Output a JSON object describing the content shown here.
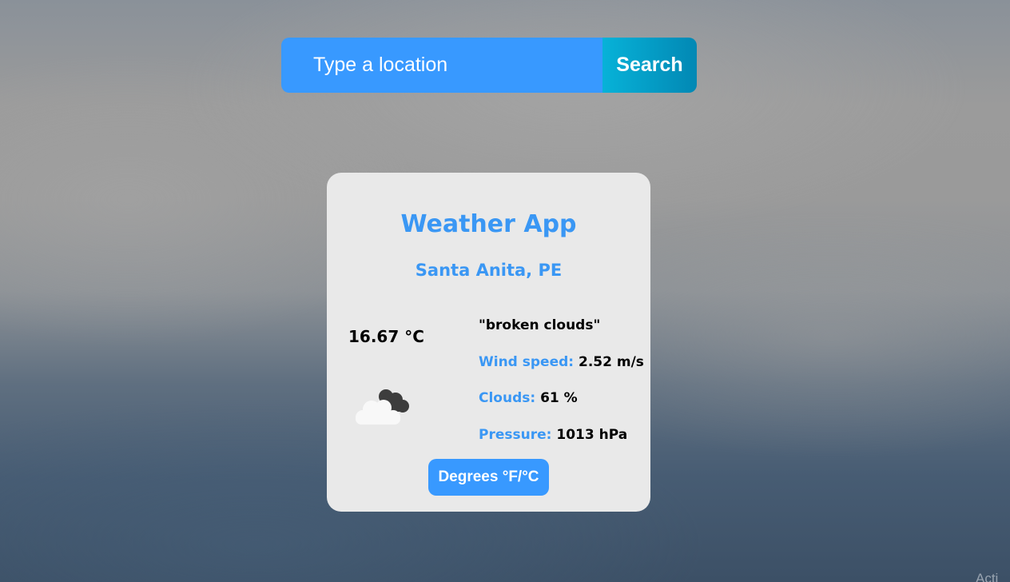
{
  "search": {
    "placeholder": "Type a location",
    "button_label": "Search"
  },
  "card": {
    "title": "Weather App",
    "location": "Santa Anita, PE",
    "temperature": "16.67 °C",
    "weather_icon": "broken-clouds-icon",
    "description": "\"broken clouds\"",
    "wind": {
      "label": "Wind speed:",
      "value": "2.52 m/s"
    },
    "clouds": {
      "label": "Clouds:",
      "value": "61 %"
    },
    "pressure": {
      "label": "Pressure:",
      "value": "1013 hPa"
    },
    "toggle_label": "Degrees °F/°C"
  },
  "overlay": {
    "corner_text": "Acti"
  },
  "colors": {
    "accent": "#3a97f4",
    "input_background": "#3899ff",
    "search_button_gradient_start": "#07b2d8",
    "search_button_gradient_end": "#0288b4",
    "card_background": "#e9e9e9"
  }
}
